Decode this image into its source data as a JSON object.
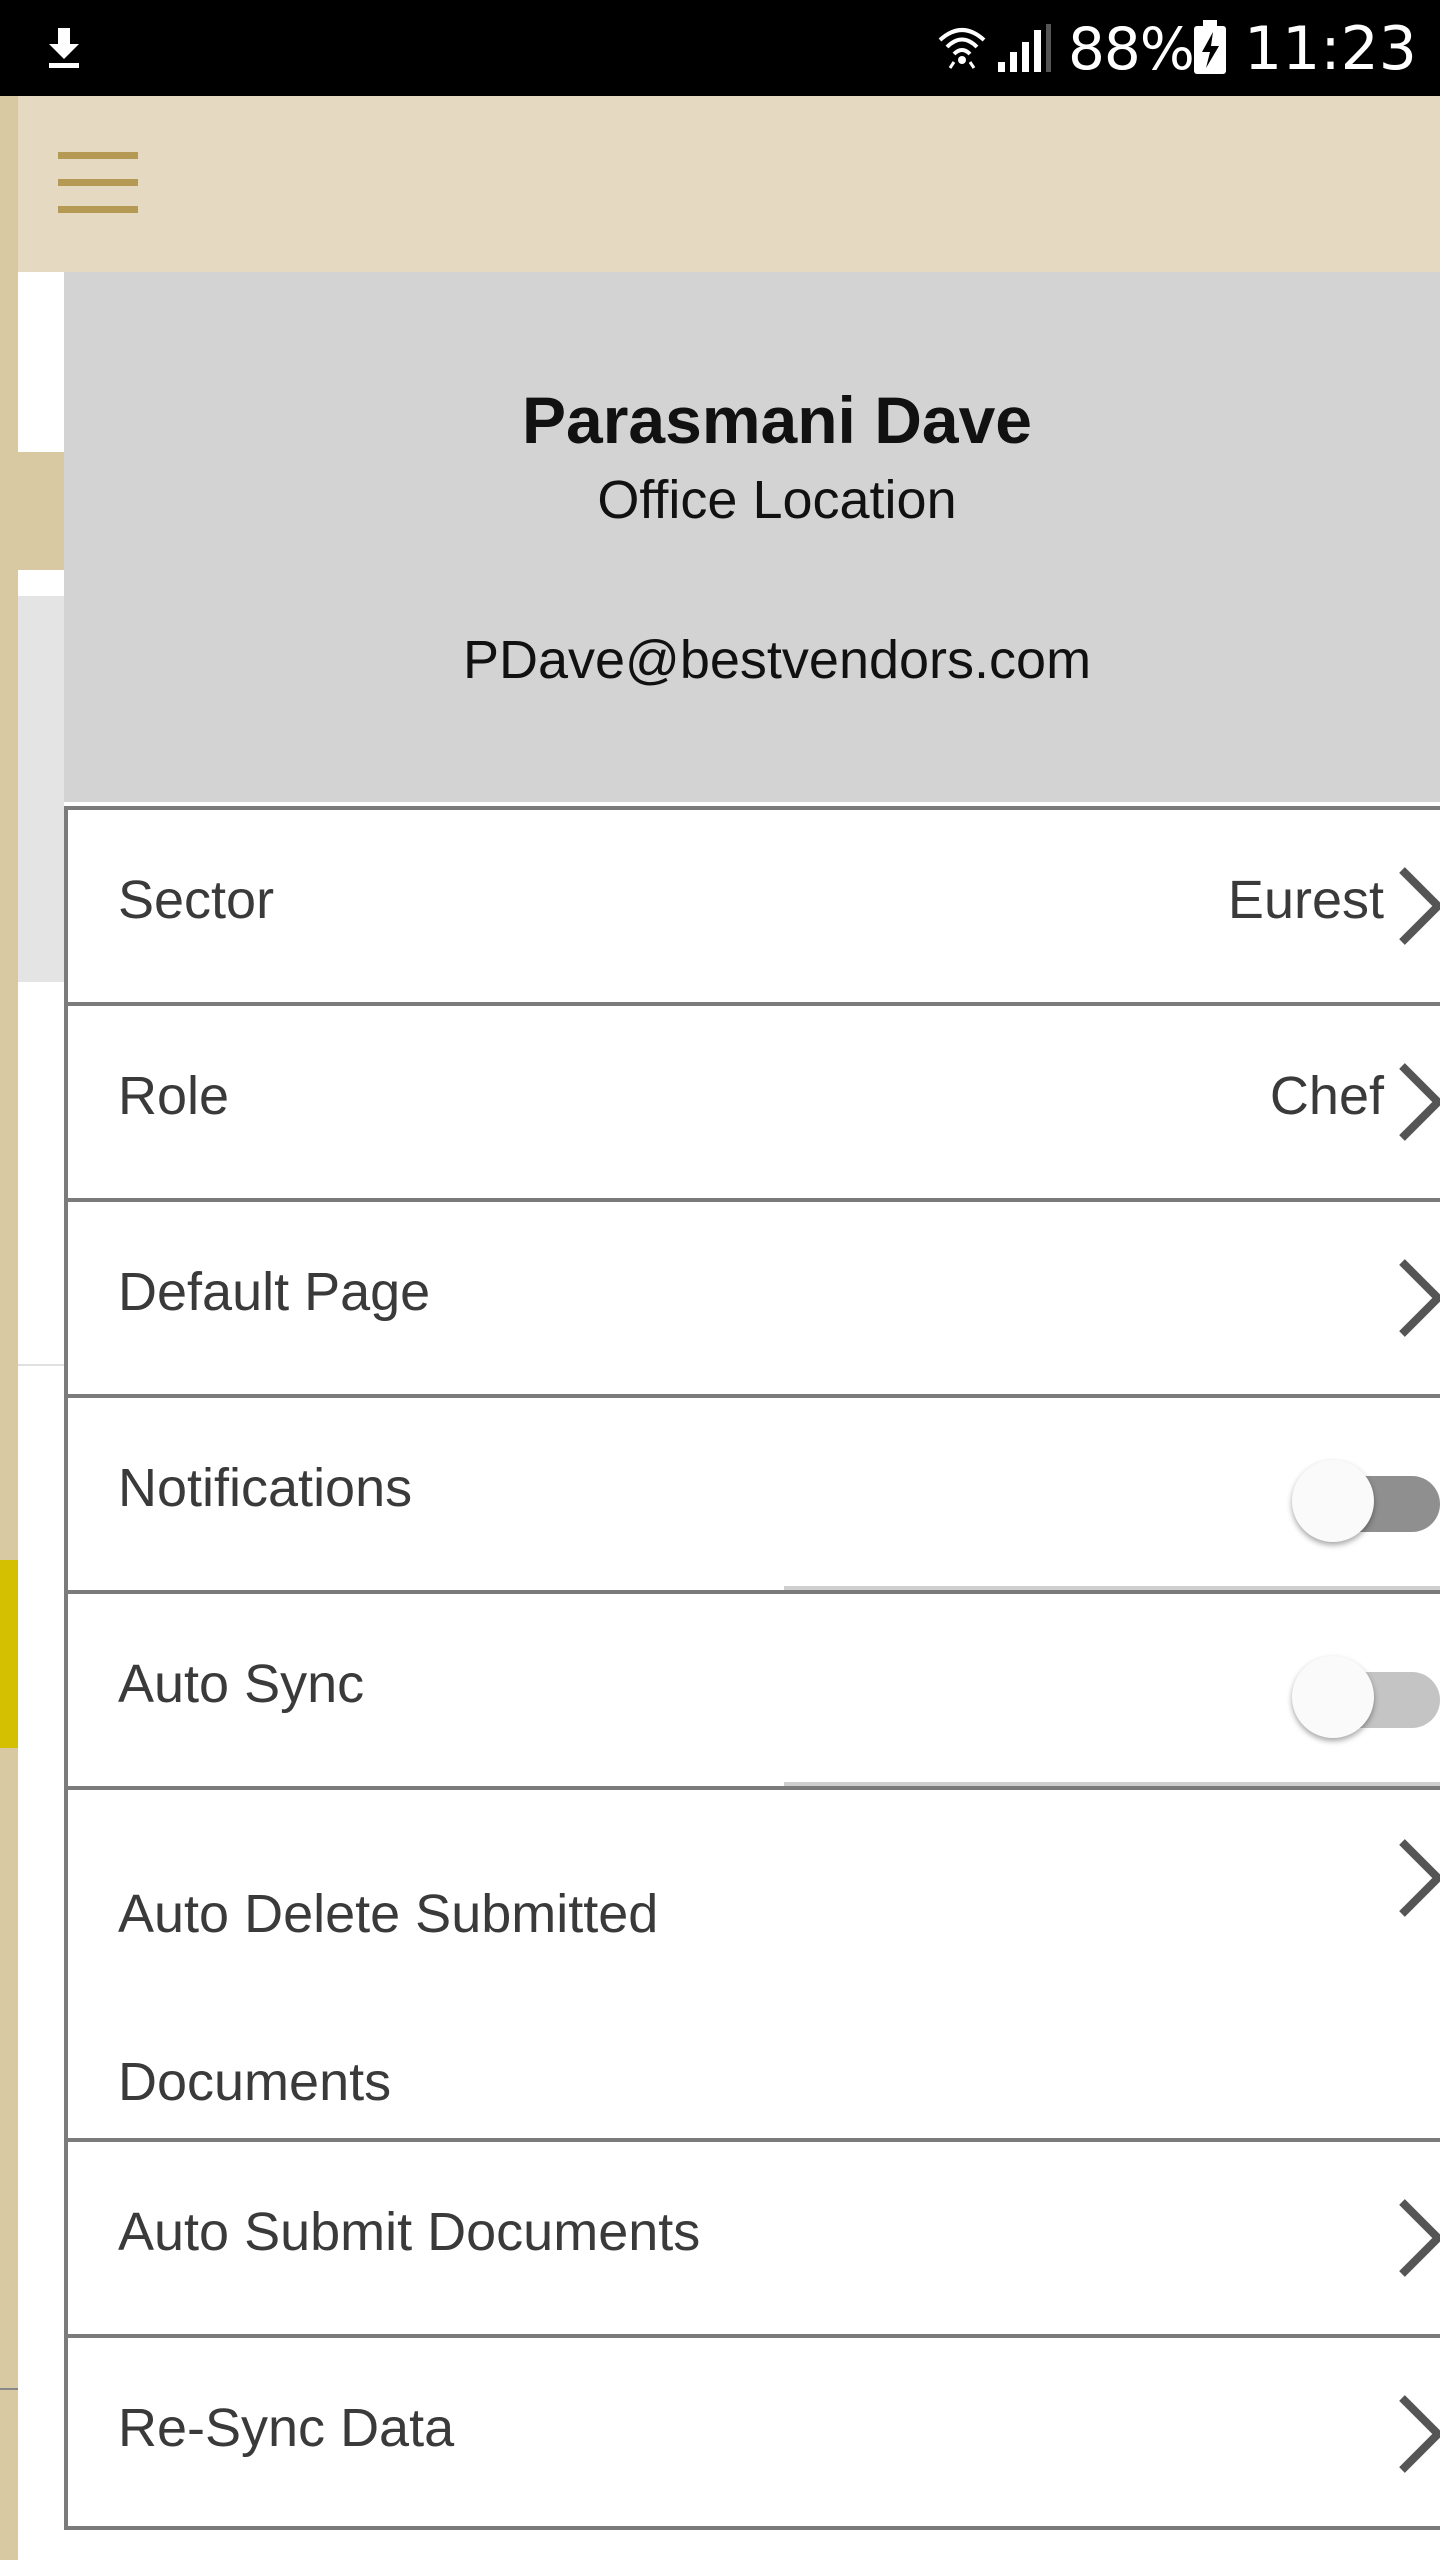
{
  "status_bar": {
    "battery_percent": "88%",
    "time": "11:23",
    "icons": [
      "download-icon",
      "wifi-icon",
      "signal-icon",
      "battery-charging-icon"
    ]
  },
  "app_bar": {
    "menu_icon": "hamburger-menu-icon",
    "colors": {
      "background": "#e5dac1",
      "icon": "#b59a56"
    }
  },
  "profile": {
    "name": "Parasmani Dave",
    "location": "Office Location",
    "email": "PDave@bestvendors.com"
  },
  "settings": {
    "sector": {
      "label": "Sector",
      "value": "Eurest"
    },
    "role": {
      "label": "Role",
      "value": "Chef"
    },
    "default_page": {
      "label": "Default Page"
    },
    "notifications": {
      "label": "Notifications",
      "enabled": false
    },
    "auto_sync": {
      "label": "Auto Sync",
      "enabled": false
    },
    "auto_delete": {
      "label": "Auto Delete Submitted Documents"
    },
    "auto_submit": {
      "label": "Auto Submit Documents"
    },
    "resync": {
      "label": "Re-Sync Data"
    }
  },
  "colors": {
    "profile_background": "#d3d3d3",
    "divider": "#7b7b7b",
    "text": "#3a3a3a"
  }
}
